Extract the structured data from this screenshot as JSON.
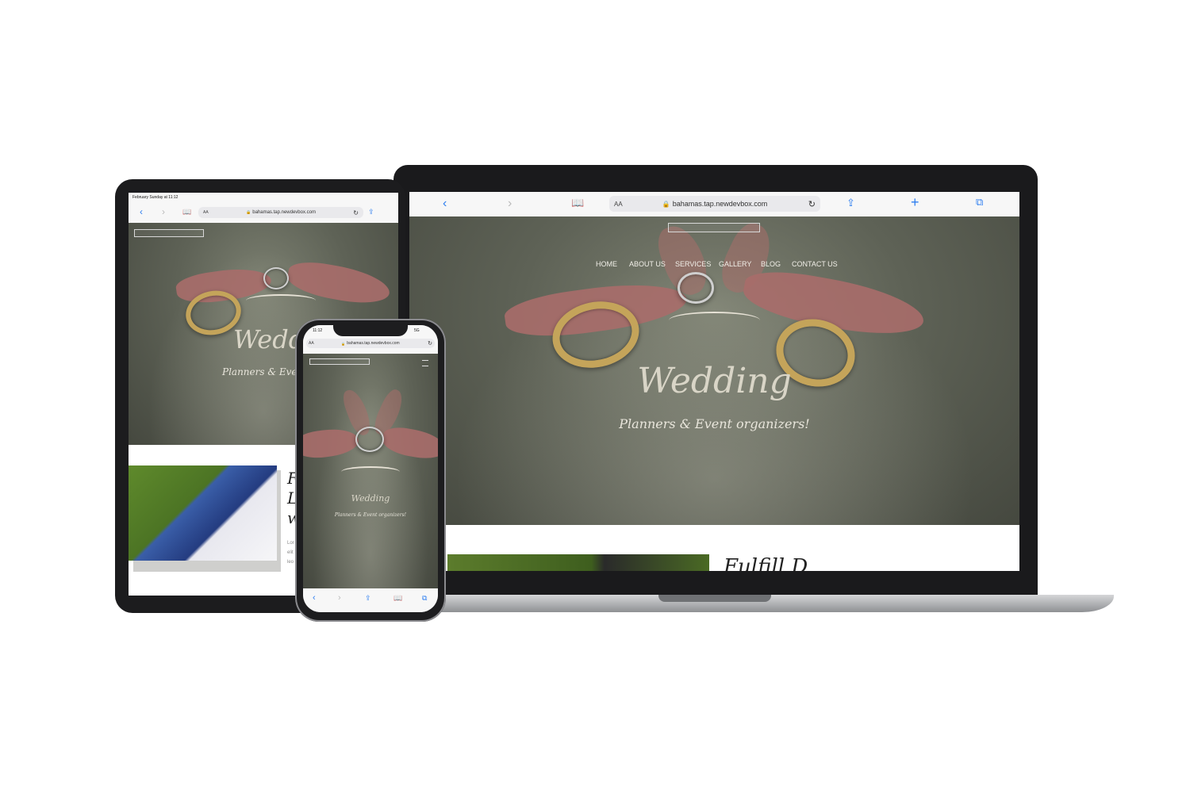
{
  "browser": {
    "url": "bahamas.tap.newdevbox.com",
    "reader_label": "AA",
    "icons": [
      "back-icon",
      "forward-icon",
      "bookmarks-icon",
      "lock-icon",
      "reload-icon",
      "share-icon",
      "new-tab-icon",
      "tabs-icon"
    ]
  },
  "site": {
    "nav": [
      "HOME",
      "ABOUT US",
      "SERVICES",
      "GALLERY",
      "BLOG",
      "CONTACT US"
    ],
    "hero_title": "Wedding",
    "hero_subtitle": "Planners & Event organizers!"
  },
  "tablet": {
    "status_time": "February Sunday at 11:12",
    "hero_title_visible": "Wedd",
    "hero_subtitle_visible": "Planners & Event o",
    "side_letters": [
      "F",
      "L",
      "w"
    ],
    "side_text": [
      "Lor",
      "elit",
      "leo"
    ]
  },
  "phone": {
    "status_time": "11:12",
    "status_network": "5G"
  },
  "laptop": {
    "lower_heading_fragment": "Fulfill       D"
  },
  "colors": {
    "safari_blue": "#2f7ff0",
    "ribbon": "#a86d6a",
    "gold": "#c4a45a",
    "hero_overlay": "#5e6256"
  }
}
